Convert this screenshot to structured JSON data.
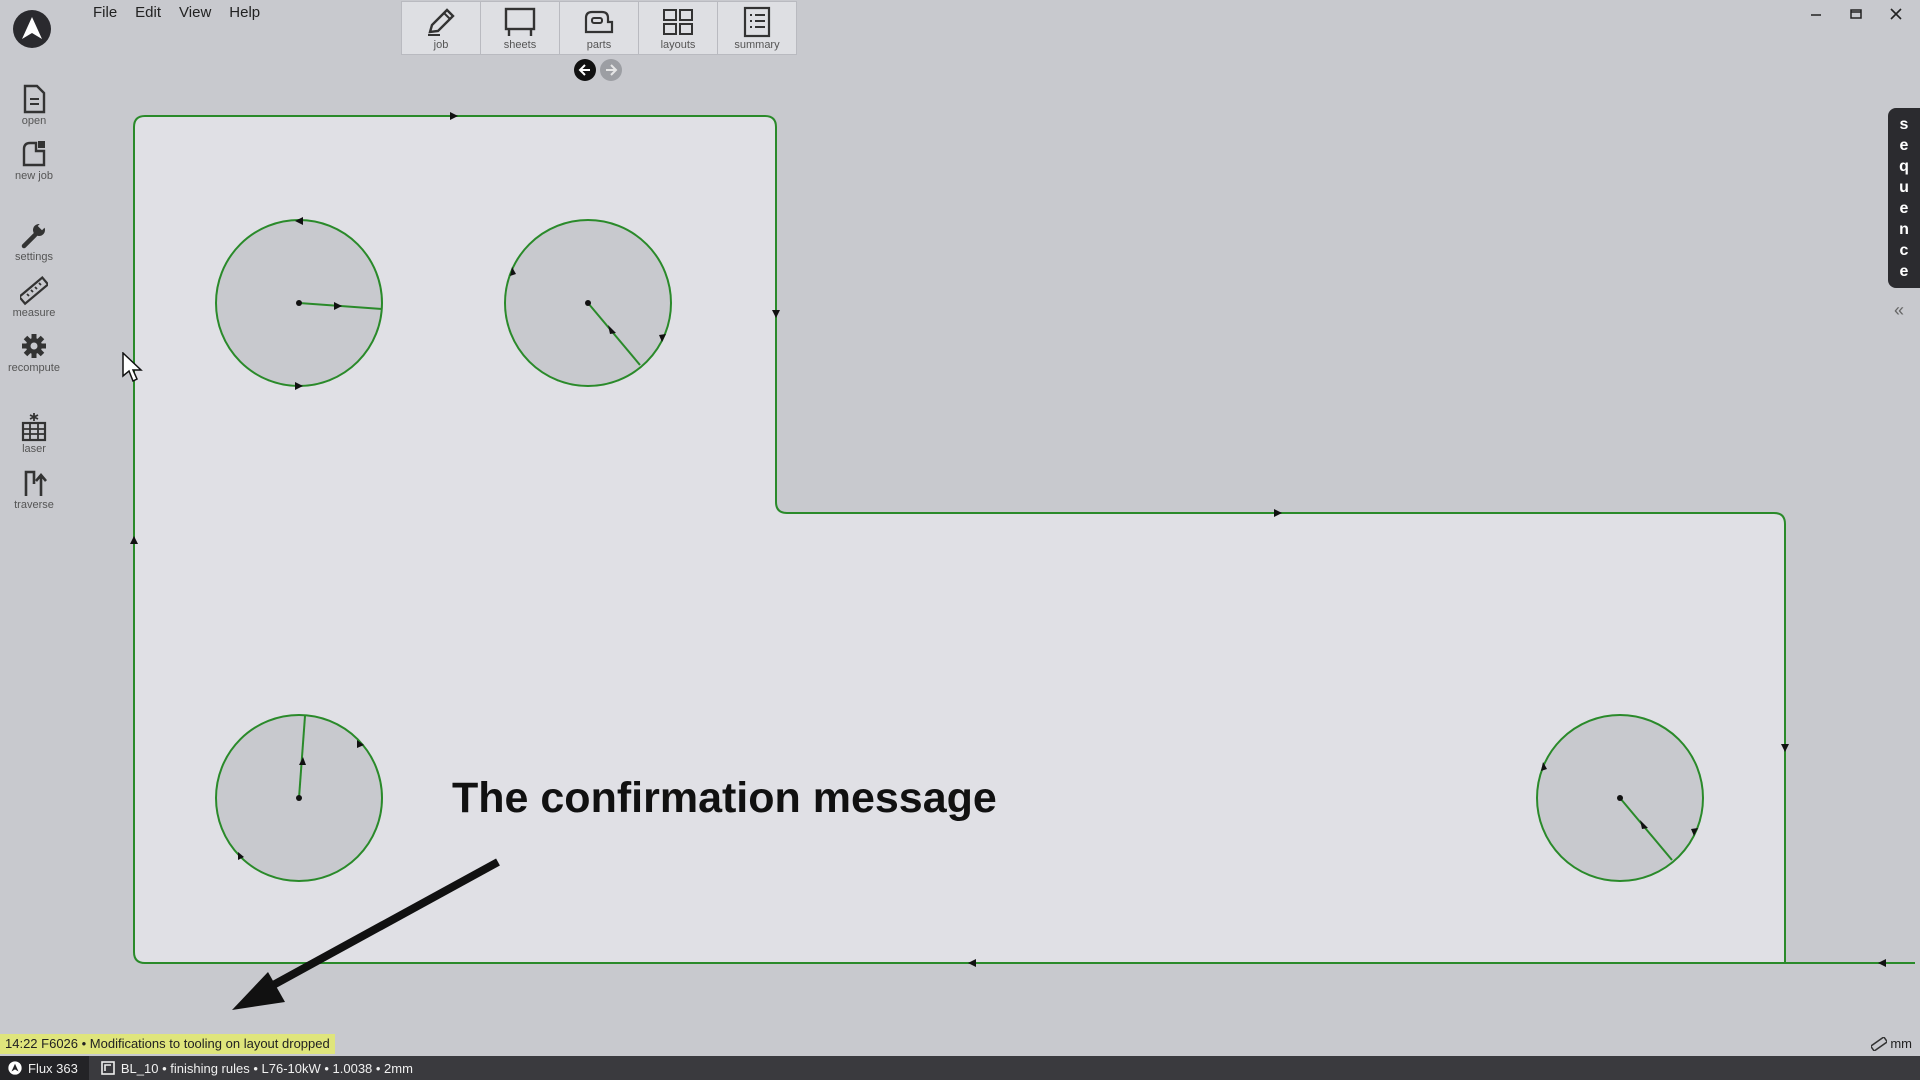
{
  "app": {
    "logo_icon": "app-logo-icon"
  },
  "menu": [
    "File",
    "Edit",
    "View",
    "Help"
  ],
  "window_controls": [
    "minimize-icon",
    "maximize-icon",
    "close-icon"
  ],
  "toolbar": [
    {
      "label": "job",
      "icon": "pencil-icon"
    },
    {
      "label": "sheets",
      "icon": "sheet-icon"
    },
    {
      "label": "parts",
      "icon": "part-icon"
    },
    {
      "label": "layouts",
      "icon": "layout-icon"
    },
    {
      "label": "summary",
      "icon": "list-icon"
    }
  ],
  "nav": {
    "back_icon": "arrow-left-icon",
    "forward_icon": "arrow-right-icon"
  },
  "sidebar": [
    {
      "label": "open",
      "icon": "document-icon"
    },
    {
      "label": "new job",
      "icon": "new-job-icon"
    },
    {
      "label": "settings",
      "icon": "wrench-icon"
    },
    {
      "label": "measure",
      "icon": "ruler-icon"
    },
    {
      "label": "recompute",
      "icon": "gear-icon"
    },
    {
      "label": "laser",
      "icon": "laser-icon"
    },
    {
      "label": "traverse",
      "icon": "traverse-icon"
    }
  ],
  "sequence_tab": {
    "letters": [
      "s",
      "e",
      "q",
      "u",
      "e",
      "n",
      "c",
      "e"
    ],
    "collapse_icon": "double-chevron-left-icon"
  },
  "annotation": {
    "text": "The confirmation message"
  },
  "status_message": "14:22  F6026 • Modifications to tooling on layout dropped",
  "unit": "mm",
  "statusbar": {
    "app_name": "Flux 363",
    "job_info": "BL_10 •  finishing rules • L76-10kW • 1.0038 • 2mm"
  },
  "colors": {
    "path": "#2a8a2a",
    "part_fill": "#e0e0e5",
    "hole_fill": "#c8c9ce",
    "status_highlight": "#dfe57c"
  }
}
